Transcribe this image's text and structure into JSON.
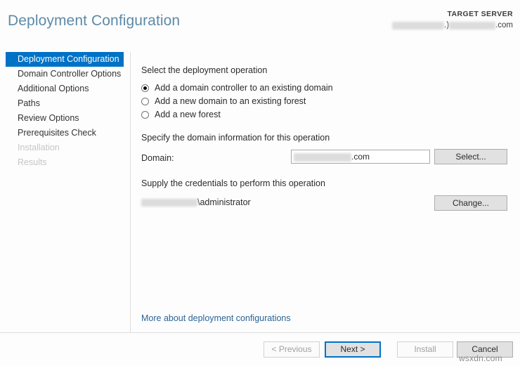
{
  "header": {
    "title": "Deployment Configuration",
    "target_server_label": "TARGET SERVER",
    "target_server_suffix": ".com",
    "target_server_separator": ".)"
  },
  "sidebar": {
    "items": [
      {
        "label": "Deployment Configuration",
        "state": "active"
      },
      {
        "label": "Domain Controller Options",
        "state": "enabled"
      },
      {
        "label": "Additional Options",
        "state": "enabled"
      },
      {
        "label": "Paths",
        "state": "enabled"
      },
      {
        "label": "Review Options",
        "state": "enabled"
      },
      {
        "label": "Prerequisites Check",
        "state": "enabled"
      },
      {
        "label": "Installation",
        "state": "disabled"
      },
      {
        "label": "Results",
        "state": "disabled"
      }
    ]
  },
  "main": {
    "operation_section_label": "Select the deployment operation",
    "operations": [
      {
        "label": "Add a domain controller to an existing domain",
        "selected": true
      },
      {
        "label": "Add a new domain to an existing forest",
        "selected": false
      },
      {
        "label": "Add a new forest",
        "selected": false
      }
    ],
    "domain_section_label": "Specify the domain information for this operation",
    "domain_field_label": "Domain:",
    "domain_value_suffix": ".com",
    "select_button_label": "Select...",
    "credentials_section_label": "Supply the credentials to perform this operation",
    "credentials_value_suffix": "\\administrator",
    "change_button_label": "Change...",
    "more_link_label": "More about deployment configurations"
  },
  "footer": {
    "previous_label": "< Previous",
    "next_label": "Next >",
    "install_label": "Install",
    "cancel_label": "Cancel"
  },
  "watermark": {
    "text": "wsxdn.com"
  },
  "colors": {
    "accent": "#0072c6",
    "title": "#5d8aa8",
    "link": "#2a6496",
    "disabled_text": "#c6c6c6"
  }
}
